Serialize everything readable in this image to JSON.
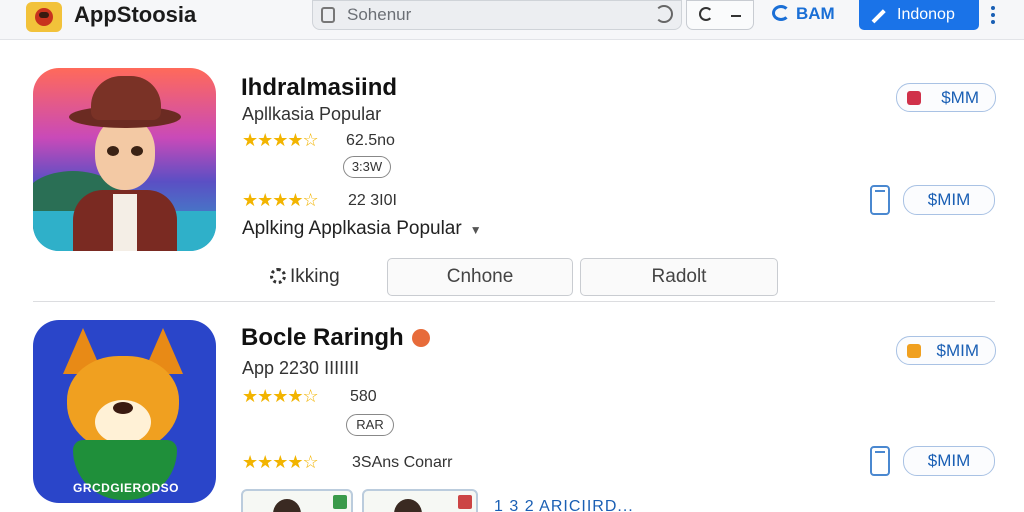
{
  "header": {
    "app_title": "AppStoosia",
    "search_placeholder": "Sohenur",
    "bam_label": "BAM",
    "lang_label": "Indonop",
    "accent": "#1a73e8"
  },
  "apps": [
    {
      "name": "Ihdralmasiind",
      "subtitle": "Apllkasia Popular",
      "stars": "★★★★☆",
      "rating_1": "62.5no",
      "pill_1": "3:3W",
      "stars_2": "★★★★☆",
      "rating_2": "22 3I0I",
      "category": "Aplking  Applkasia Popular",
      "caret": "▼",
      "get_label_top": "$MM",
      "get_label_bottom": "$MIM"
    },
    {
      "name": "Bocle Raringh",
      "subtitle": "App 2230 IIIIIII",
      "stars": "★★★★☆",
      "rating_1": "580",
      "pill_1": "RAR",
      "stars_2": "★★★★☆",
      "rating_2": "3SAns Conarr",
      "get_label_top": "$MIM",
      "get_label_bottom": "$MIM",
      "banner": "GRCDGIERODSO"
    }
  ],
  "tabs": {
    "link": "Ikking",
    "button_1": "Cnhone",
    "button_2": "Radolt"
  },
  "peek_text": "1 3 2 ARICIIRD..."
}
